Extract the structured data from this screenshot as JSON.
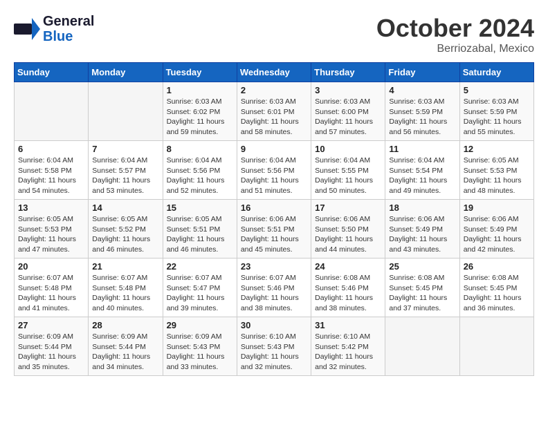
{
  "header": {
    "logo_line1": "General",
    "logo_line2": "Blue",
    "month": "October 2024",
    "location": "Berriozabal, Mexico"
  },
  "columns": [
    "Sunday",
    "Monday",
    "Tuesday",
    "Wednesday",
    "Thursday",
    "Friday",
    "Saturday"
  ],
  "weeks": [
    [
      {
        "day": "",
        "info": ""
      },
      {
        "day": "",
        "info": ""
      },
      {
        "day": "1",
        "info": "Sunrise: 6:03 AM\nSunset: 6:02 PM\nDaylight: 11 hours and 59 minutes."
      },
      {
        "day": "2",
        "info": "Sunrise: 6:03 AM\nSunset: 6:01 PM\nDaylight: 11 hours and 58 minutes."
      },
      {
        "day": "3",
        "info": "Sunrise: 6:03 AM\nSunset: 6:00 PM\nDaylight: 11 hours and 57 minutes."
      },
      {
        "day": "4",
        "info": "Sunrise: 6:03 AM\nSunset: 5:59 PM\nDaylight: 11 hours and 56 minutes."
      },
      {
        "day": "5",
        "info": "Sunrise: 6:03 AM\nSunset: 5:59 PM\nDaylight: 11 hours and 55 minutes."
      }
    ],
    [
      {
        "day": "6",
        "info": "Sunrise: 6:04 AM\nSunset: 5:58 PM\nDaylight: 11 hours and 54 minutes."
      },
      {
        "day": "7",
        "info": "Sunrise: 6:04 AM\nSunset: 5:57 PM\nDaylight: 11 hours and 53 minutes."
      },
      {
        "day": "8",
        "info": "Sunrise: 6:04 AM\nSunset: 5:56 PM\nDaylight: 11 hours and 52 minutes."
      },
      {
        "day": "9",
        "info": "Sunrise: 6:04 AM\nSunset: 5:56 PM\nDaylight: 11 hours and 51 minutes."
      },
      {
        "day": "10",
        "info": "Sunrise: 6:04 AM\nSunset: 5:55 PM\nDaylight: 11 hours and 50 minutes."
      },
      {
        "day": "11",
        "info": "Sunrise: 6:04 AM\nSunset: 5:54 PM\nDaylight: 11 hours and 49 minutes."
      },
      {
        "day": "12",
        "info": "Sunrise: 6:05 AM\nSunset: 5:53 PM\nDaylight: 11 hours and 48 minutes."
      }
    ],
    [
      {
        "day": "13",
        "info": "Sunrise: 6:05 AM\nSunset: 5:53 PM\nDaylight: 11 hours and 47 minutes."
      },
      {
        "day": "14",
        "info": "Sunrise: 6:05 AM\nSunset: 5:52 PM\nDaylight: 11 hours and 46 minutes."
      },
      {
        "day": "15",
        "info": "Sunrise: 6:05 AM\nSunset: 5:51 PM\nDaylight: 11 hours and 46 minutes."
      },
      {
        "day": "16",
        "info": "Sunrise: 6:06 AM\nSunset: 5:51 PM\nDaylight: 11 hours and 45 minutes."
      },
      {
        "day": "17",
        "info": "Sunrise: 6:06 AM\nSunset: 5:50 PM\nDaylight: 11 hours and 44 minutes."
      },
      {
        "day": "18",
        "info": "Sunrise: 6:06 AM\nSunset: 5:49 PM\nDaylight: 11 hours and 43 minutes."
      },
      {
        "day": "19",
        "info": "Sunrise: 6:06 AM\nSunset: 5:49 PM\nDaylight: 11 hours and 42 minutes."
      }
    ],
    [
      {
        "day": "20",
        "info": "Sunrise: 6:07 AM\nSunset: 5:48 PM\nDaylight: 11 hours and 41 minutes."
      },
      {
        "day": "21",
        "info": "Sunrise: 6:07 AM\nSunset: 5:48 PM\nDaylight: 11 hours and 40 minutes."
      },
      {
        "day": "22",
        "info": "Sunrise: 6:07 AM\nSunset: 5:47 PM\nDaylight: 11 hours and 39 minutes."
      },
      {
        "day": "23",
        "info": "Sunrise: 6:07 AM\nSunset: 5:46 PM\nDaylight: 11 hours and 38 minutes."
      },
      {
        "day": "24",
        "info": "Sunrise: 6:08 AM\nSunset: 5:46 PM\nDaylight: 11 hours and 38 minutes."
      },
      {
        "day": "25",
        "info": "Sunrise: 6:08 AM\nSunset: 5:45 PM\nDaylight: 11 hours and 37 minutes."
      },
      {
        "day": "26",
        "info": "Sunrise: 6:08 AM\nSunset: 5:45 PM\nDaylight: 11 hours and 36 minutes."
      }
    ],
    [
      {
        "day": "27",
        "info": "Sunrise: 6:09 AM\nSunset: 5:44 PM\nDaylight: 11 hours and 35 minutes."
      },
      {
        "day": "28",
        "info": "Sunrise: 6:09 AM\nSunset: 5:44 PM\nDaylight: 11 hours and 34 minutes."
      },
      {
        "day": "29",
        "info": "Sunrise: 6:09 AM\nSunset: 5:43 PM\nDaylight: 11 hours and 33 minutes."
      },
      {
        "day": "30",
        "info": "Sunrise: 6:10 AM\nSunset: 5:43 PM\nDaylight: 11 hours and 32 minutes."
      },
      {
        "day": "31",
        "info": "Sunrise: 6:10 AM\nSunset: 5:42 PM\nDaylight: 11 hours and 32 minutes."
      },
      {
        "day": "",
        "info": ""
      },
      {
        "day": "",
        "info": ""
      }
    ]
  ]
}
